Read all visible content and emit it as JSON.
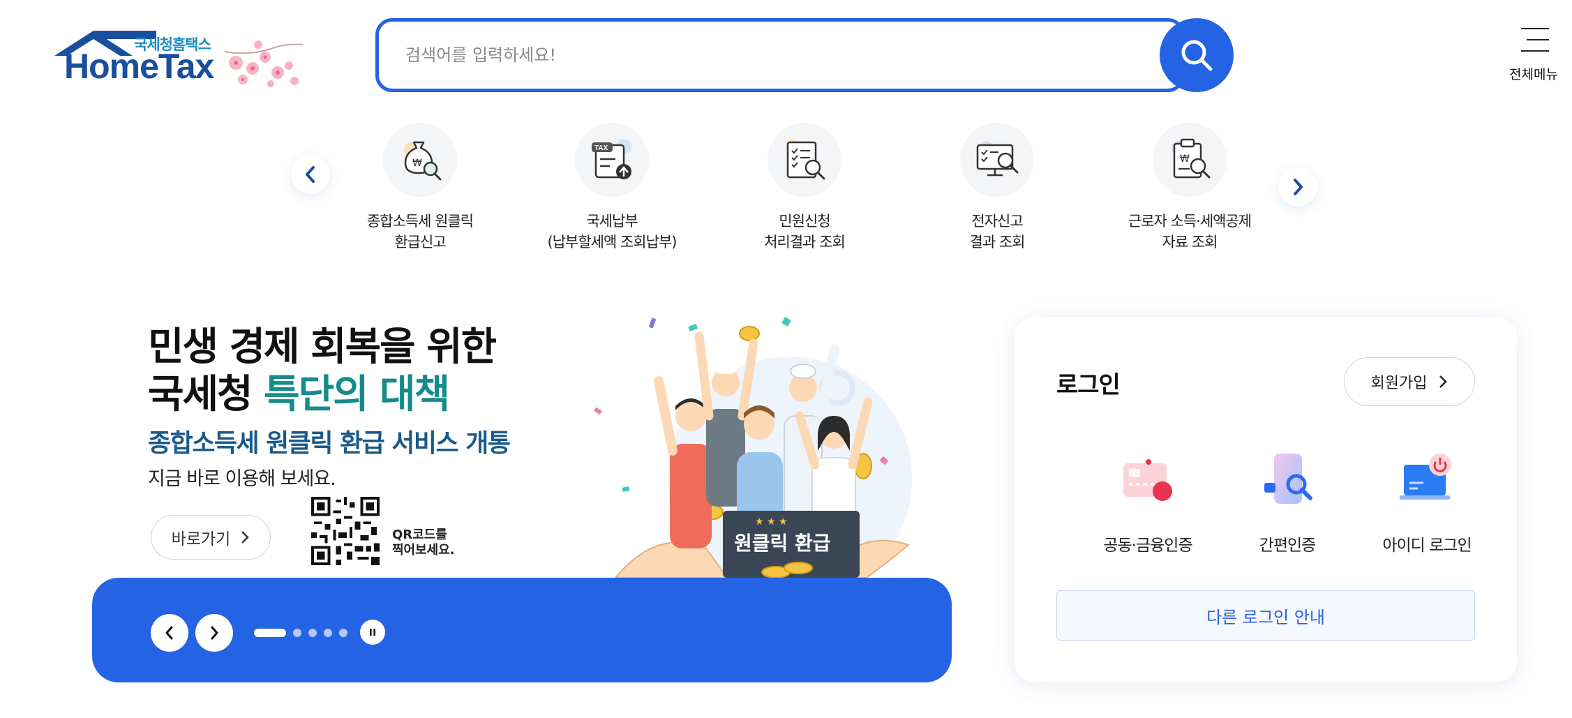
{
  "header": {
    "logo_small": "국세청홈택스",
    "logo_big": "HomeTax",
    "search_placeholder": "검색어를 입력하세요!",
    "menu_label": "전체메뉴"
  },
  "quick_menu": [
    {
      "line1": "종합소득세 원클릭",
      "line2": "환급신고",
      "icon": "money-bag-search-icon"
    },
    {
      "line1": "국세납부",
      "line2": "(납부할세액 조회납부)",
      "icon": "tax-upload-icon"
    },
    {
      "line1": "민원신청",
      "line2": "처리결과 조회",
      "icon": "checklist-search-icon"
    },
    {
      "line1": "전자신고",
      "line2": "결과 조회",
      "icon": "monitor-search-icon"
    },
    {
      "line1": "근로자 소득·세액공제",
      "line2": "자료 조회",
      "icon": "document-search-icon"
    }
  ],
  "banner": {
    "title_line1": "민생 경제 회복을 위한",
    "title_line2_plain": "국세청 ",
    "title_line2_highlight": "특단의 대책",
    "subtitle": "종합소득세 원클릭 환급 서비스 개통",
    "description": "지금 바로 이용해 보세요.",
    "go_button": "바로가기",
    "qr_caption_line1": "QR코드를",
    "qr_caption_line2": "찍어보세요.",
    "illustration_sign": "원클릭 환급",
    "slide_count": 5,
    "active_slide": 1
  },
  "login": {
    "title": "로그인",
    "join_button": "회원가입",
    "methods": [
      {
        "label": "공동·금융인증",
        "icon": "certificate-card-icon"
      },
      {
        "label": "간편인증",
        "icon": "phone-search-icon"
      },
      {
        "label": "아이디 로그인",
        "icon": "laptop-power-icon"
      }
    ],
    "other_login": "다른 로그인 안내"
  },
  "colors": {
    "primary": "#2563e5",
    "logo_navy": "#1a4fa0",
    "logo_teal": "#1a8cc7",
    "highlight_teal": "#168b8c"
  }
}
